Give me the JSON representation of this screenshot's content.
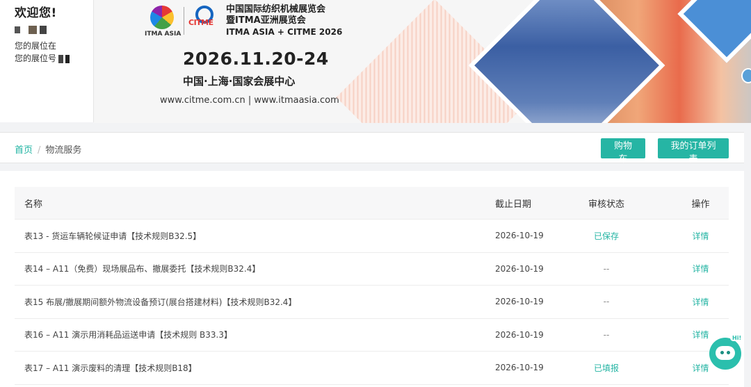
{
  "welcome": {
    "title": "欢迎您!",
    "booth_location_label": "您的展位在",
    "booth_number_label": "您的展位号"
  },
  "banner": {
    "logo_itma": "ITMA ASIA",
    "logo_citme": "CITME",
    "title_cn_1": "中国国际纺织机械展览会",
    "title_cn_2": "暨ITMA亚洲展览会",
    "title_en": "ITMA  ASIA + CITME 2026",
    "date": "2026.11.20-24",
    "venue": "中国·上海·国家会展中心",
    "url": "www.citme.com.cn | www.itmaasia.com"
  },
  "breadcrumb": {
    "home": "首页",
    "separator": "/",
    "current": "物流服务"
  },
  "toolbar": {
    "cart_label": "购物车",
    "orders_label": "我的订单列表"
  },
  "table": {
    "headers": {
      "name": "名称",
      "deadline": "截止日期",
      "status": "审核状态",
      "action": "操作"
    },
    "rows": [
      {
        "name": "表13 - 货运车辆轮候证申请【技术规则B32.5】",
        "deadline": "2026-10-19",
        "status": "已保存",
        "action": "详情"
      },
      {
        "name": "表14 – A11（免费）现场展品布、撤展委托【技术规则B32.4】",
        "deadline": "2026-10-19",
        "status": "--",
        "action": "详情"
      },
      {
        "name": "表15 布展/撤展期间额外物流设备预订(展台搭建材料)【技术规则B32.4】",
        "deadline": "2026-10-19",
        "status": "--",
        "action": "详情"
      },
      {
        "name": "表16 – A11 演示用消耗品运送申请【技术规则 B33.3】",
        "deadline": "2026-10-19",
        "status": "--",
        "action": "详情"
      },
      {
        "name": "表17 – A11 演示废料的清理【技术规则B18】",
        "deadline": "2026-10-19",
        "status": "已填报",
        "action": "详情"
      }
    ]
  },
  "assistant": {
    "bubble": "Hi!"
  },
  "colors": {
    "accent": "#26b5a4",
    "link": "#1fb3a2"
  }
}
